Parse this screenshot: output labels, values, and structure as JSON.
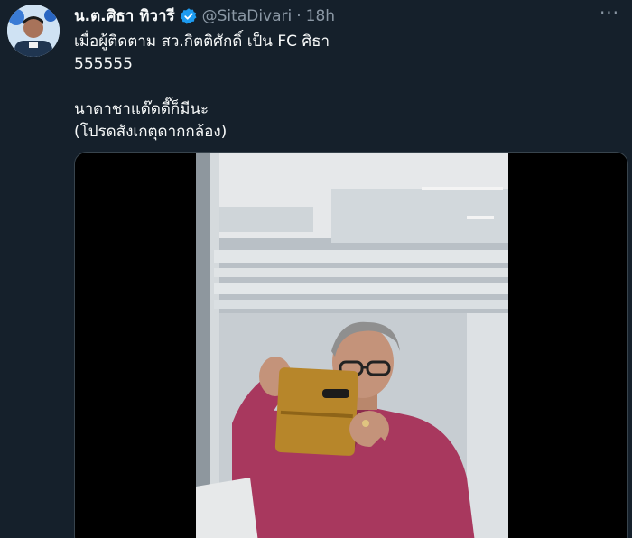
{
  "tweet": {
    "display_name": "น.ต.ศิธา ทิวารี",
    "verified_icon": "verified-badge-icon",
    "handle": "@SitaDivari",
    "separator": "·",
    "time": "18h",
    "more_icon": "more-options-icon",
    "more_label": "···",
    "lines": [
      "เมื่อผู้ติดตาม สว.กิตติศักดิ์ เป็น FC ศิธา",
      "555555",
      "นาดาชาแด๊ดดี๊ก็มีนะ",
      "(โปรดสังเกตุดากกล้อง)"
    ]
  },
  "colors": {
    "background": "#15202b",
    "text": "#f7f9f9",
    "secondary_text": "#8b98a5",
    "verified": "#1d9bf0",
    "border": "#38444d",
    "shirt": "#a8385e",
    "phone_case": "#b7862a"
  }
}
